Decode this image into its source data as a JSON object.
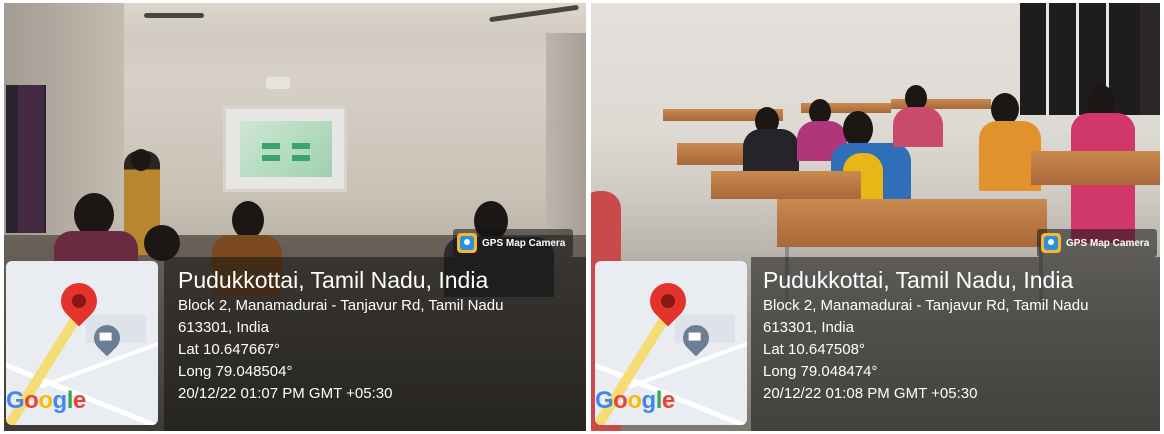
{
  "photos": [
    {
      "badge_icon": "gps-map-camera-icon",
      "badge_text": "GPS Map Camera",
      "location_title": "Pudukkottai, Tamil Nadu, India",
      "address_line1": "Block 2, Manamadurai - Tanjavur Rd, Tamil Nadu",
      "address_line2": "613301, India",
      "latitude": "Lat 10.647667°",
      "longitude": "Long 79.048504°",
      "timestamp": "20/12/22 01:07 PM GMT +05:30",
      "map_brand": {
        "g1": "G",
        "o1": "o",
        "o2": "o",
        "g2": "g",
        "l": "l",
        "e": "e"
      }
    },
    {
      "badge_icon": "gps-map-camera-icon",
      "badge_text": "GPS Map Camera",
      "location_title": "Pudukkottai, Tamil Nadu, India",
      "address_line1": "Block 2, Manamadurai - Tanjavur Rd, Tamil Nadu",
      "address_line2": "613301, India",
      "latitude": "Lat 10.647508°",
      "longitude": "Long 79.048474°",
      "timestamp": "20/12/22 01:08 PM GMT +05:30",
      "map_brand": {
        "g1": "G",
        "o1": "o",
        "o2": "o",
        "g2": "g",
        "l": "l",
        "e": "e"
      }
    }
  ],
  "colors": {
    "pin_red": "#e4332c",
    "pin_grey": "#6c7f92",
    "road_yellow": "#f6dc74",
    "overlay": "rgba(20,20,20,0.55)"
  }
}
